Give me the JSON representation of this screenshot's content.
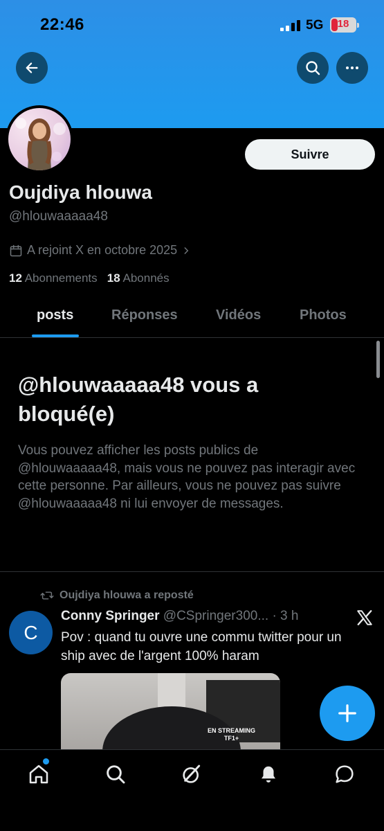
{
  "status_bar": {
    "time": "22:46",
    "network": "5G",
    "battery": "18"
  },
  "colors": {
    "accent": "#1d9bf0",
    "banner": "#1d9bf0",
    "muted": "#71767b",
    "battery_low": "#e0243a"
  },
  "icons": {
    "back": "arrow-left-icon",
    "search": "search-icon",
    "more": "more-horizontal-icon",
    "calendar": "calendar-icon",
    "repost": "repost-icon",
    "x_logo": "x-logo-icon",
    "compose": "plus-icon",
    "home": "home-icon",
    "explore": "search-icon",
    "grok": "grok-icon",
    "notifications": "bell-icon",
    "messages": "message-icon"
  },
  "profile": {
    "follow_label": "Suivre",
    "display_name": "Oujdiya hlouwa",
    "handle": "@hlouwaaaaa48",
    "joined": "A rejoint X en octobre 2025",
    "following_count": "12",
    "following_label": "Abonnements",
    "followers_count": "18",
    "followers_label": "Abonnés"
  },
  "tabs": [
    {
      "label": "posts",
      "active": true
    },
    {
      "label": "Réponses",
      "active": false
    },
    {
      "label": "Vidéos",
      "active": false
    },
    {
      "label": "Photos",
      "active": false
    }
  ],
  "blocked": {
    "title": "@hlouwaaaaa48 vous a bloqué(e)",
    "body": "Vous pouvez afficher les posts publics de @hlouwaaaaa48, mais vous ne pouvez pas interagir avec cette personne. Par ailleurs, vous ne pouvez pas suivre @hlouwaaaaa48 ni lui envoyer de messages."
  },
  "tweet": {
    "repost_label": "Oujdiya hlouwa a reposté",
    "avatar_letter": "C",
    "author": "Conny Springer",
    "handle": "@CSpringer300...",
    "time": "· 3 h",
    "text": "Pov : quand tu ouvre une commu twitter pour un ship avec de l'argent 100% haram",
    "media_badge_line1": "EN STREAMING",
    "media_badge_line2": "TF1+"
  }
}
